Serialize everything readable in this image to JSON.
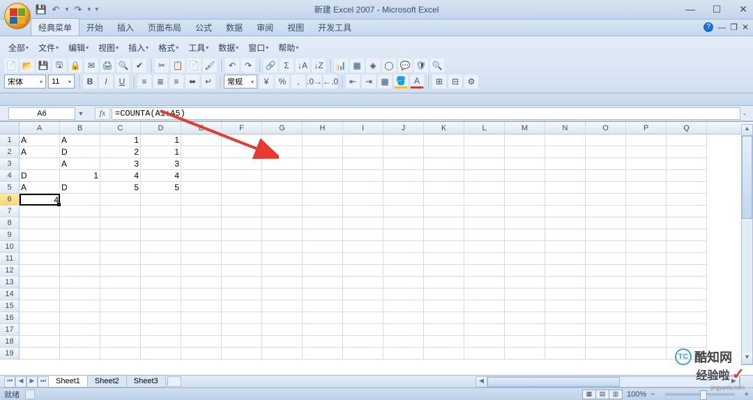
{
  "app": {
    "title": "新建 Excel 2007 - Microsoft Excel"
  },
  "qat": {
    "save": "💾",
    "undo": "↶",
    "redo": "↷"
  },
  "win": {
    "min": "—",
    "max": "☐",
    "close": "✕"
  },
  "tabs": [
    "经典菜单",
    "开始",
    "插入",
    "页面布局",
    "公式",
    "数据",
    "审阅",
    "视图",
    "开发工具"
  ],
  "menus": [
    "全部",
    "文件",
    "编辑",
    "视图",
    "插入",
    "格式",
    "工具",
    "数据",
    "窗口",
    "帮助"
  ],
  "font": {
    "name": "宋体",
    "size": "11"
  },
  "style_combo": "常规",
  "name_box": "A6",
  "formula": "=COUNTA(A1:A5)",
  "columns": [
    "A",
    "B",
    "C",
    "D",
    "E",
    "F",
    "G",
    "H",
    "I",
    "J",
    "K",
    "L",
    "M",
    "N",
    "O",
    "P",
    "Q"
  ],
  "row_count": 19,
  "active_row": 6,
  "active_cell": "A6",
  "grid": {
    "1": {
      "A": "A",
      "B": "A",
      "C": "1",
      "D": "1"
    },
    "2": {
      "A": "A",
      "B": "D",
      "C": "2",
      "D": "1"
    },
    "3": {
      "A": "",
      "B": "A",
      "C": "3",
      "D": "3"
    },
    "4": {
      "A": "D",
      "B": "1",
      "C": "4",
      "D": "4"
    },
    "5": {
      "A": "A",
      "B": "D",
      "C": "5",
      "D": "5"
    },
    "6": {
      "A": "4"
    }
  },
  "sheets": [
    "Sheet1",
    "Sheet2",
    "Sheet3"
  ],
  "active_sheet": 0,
  "status": {
    "ready": "就绪",
    "zoom": "100%"
  },
  "watermarks": {
    "w1": "酷知网",
    "w2": "经验啦",
    "url": "jingyanla.com"
  }
}
